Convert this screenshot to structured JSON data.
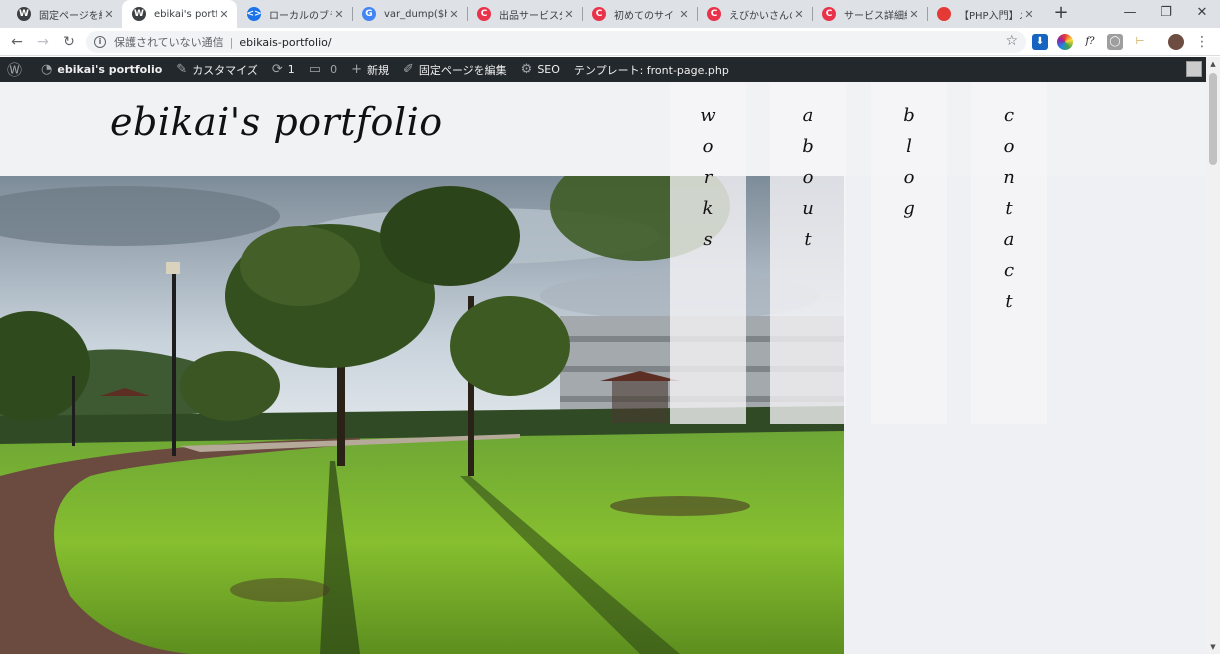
{
  "browser": {
    "tabs": [
      {
        "title": "固定ページを編集",
        "favicon": "wordpress-icon",
        "color": "#3c4043",
        "glyph": "W"
      },
      {
        "title": "ebikai's portfolio",
        "favicon": "wordpress-icon",
        "color": "#3c4043",
        "glyph": "W"
      },
      {
        "title": "ローカルのブラウザ",
        "favicon": "code-icon",
        "color": "#1a73e8",
        "glyph": "<>"
      },
      {
        "title": "var_dump($hoge",
        "favicon": "google-icon",
        "color": "#4285f4",
        "glyph": "G"
      },
      {
        "title": "出品サービス分析",
        "favicon": "coconala-icon",
        "color": "#e8334a",
        "glyph": "C"
      },
      {
        "title": "初めてのサイト作",
        "favicon": "coconala-icon",
        "color": "#e8334a",
        "glyph": "C"
      },
      {
        "title": "えびかいさんのプ",
        "favicon": "coconala-icon",
        "color": "#e8334a",
        "glyph": "C"
      },
      {
        "title": "サービス詳細編集",
        "favicon": "coconala-icon",
        "color": "#e8334a",
        "glyph": "C"
      },
      {
        "title": "【PHP入門】メー",
        "favicon": "qiita-icon",
        "color": "#e53935",
        "glyph": ""
      }
    ],
    "active_tab": 1,
    "new_tab_label": "+",
    "omnibox": {
      "security_text": "保護されていない通信",
      "url": "ebikais-portfolio/"
    }
  },
  "adminbar": {
    "site_name": "ebikai's portfolio",
    "customize": "カスタマイズ",
    "updates_count": "1",
    "comments_count": "0",
    "new": "新規",
    "edit_page": "固定ページを編集",
    "seo": "SEO",
    "template": "テンプレート: front-page.php"
  },
  "site": {
    "title": "ebikai's portfolio",
    "nav": [
      {
        "label": "works",
        "letters": [
          "w",
          "o",
          "r",
          "k",
          "s"
        ]
      },
      {
        "label": "about",
        "letters": [
          "a",
          "b",
          "o",
          "u",
          "t"
        ]
      },
      {
        "label": "blog",
        "letters": [
          "b",
          "l",
          "o",
          "g"
        ]
      },
      {
        "label": "contact",
        "letters": [
          "c",
          "o",
          "n",
          "t",
          "a",
          "c",
          "t"
        ]
      }
    ]
  },
  "colors": {
    "adminbar_bg": "#23282d",
    "page_bg": "#eef0f3",
    "grass": "#7ab833"
  }
}
